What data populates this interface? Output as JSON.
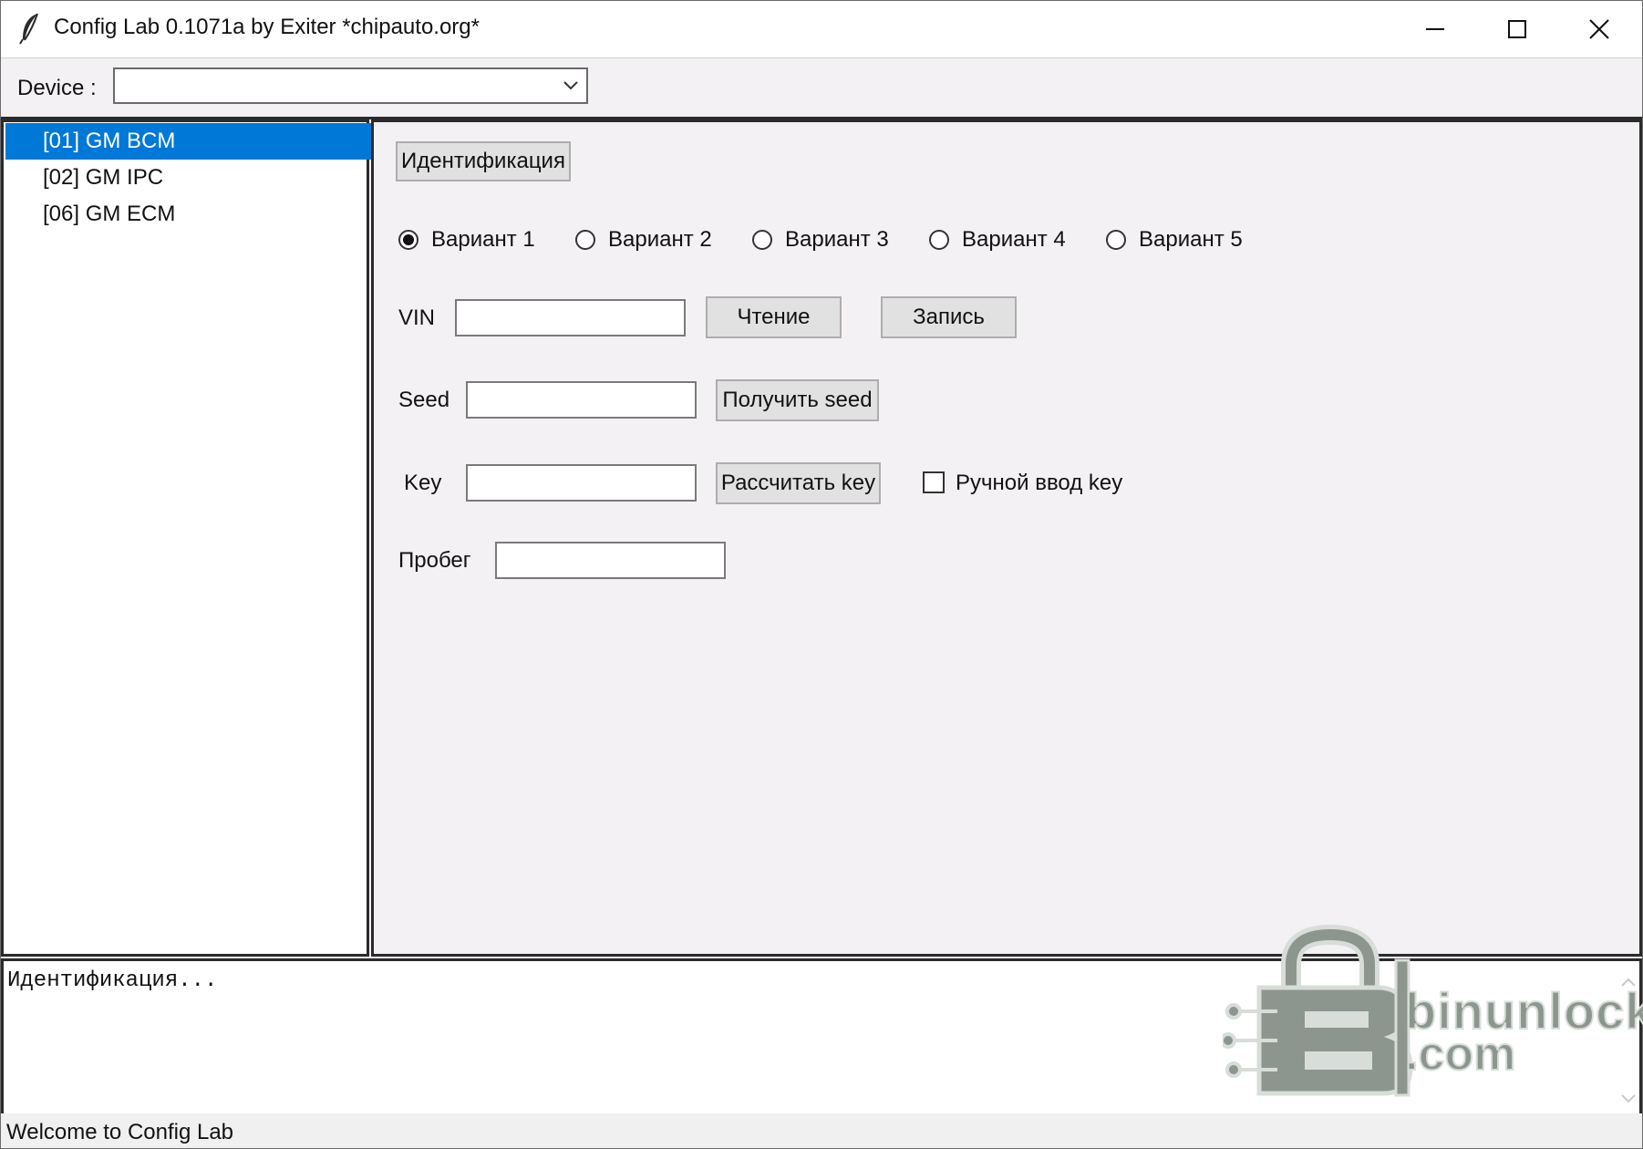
{
  "window": {
    "title": "Config Lab 0.1071a by Exiter *chipauto.org*",
    "icons": {
      "app": "feather-icon",
      "minimize": "minimize-icon",
      "maximize": "maximize-icon",
      "close": "close-icon"
    }
  },
  "device_bar": {
    "label": "Device :",
    "selected_value": ""
  },
  "device_list": {
    "items": [
      {
        "label": "[01] GM BCM",
        "selected": true
      },
      {
        "label": "[02] GM IPC",
        "selected": false
      },
      {
        "label": "[06] GM ECM",
        "selected": false
      }
    ],
    "selected_color": "#0078d7"
  },
  "main": {
    "identify_button": "Идентификация",
    "variants": [
      {
        "label": "Вариант 1",
        "checked": true
      },
      {
        "label": "Вариант 2",
        "checked": false
      },
      {
        "label": "Вариант 3",
        "checked": false
      },
      {
        "label": "Вариант 4",
        "checked": false
      },
      {
        "label": "Вариант 5",
        "checked": false
      }
    ],
    "vin": {
      "label": "VIN",
      "value": "",
      "read_button": "Чтение",
      "write_button": "Запись"
    },
    "seed": {
      "label": "Seed",
      "value": "",
      "get_button": "Получить seed"
    },
    "key": {
      "label": "Key",
      "value": "",
      "calc_button": "Рассчитать key",
      "manual_label": "Ручной ввод key",
      "manual_checked": false
    },
    "mileage": {
      "label": "Пробег",
      "value": ""
    }
  },
  "log": {
    "text": "Идентификация..."
  },
  "watermark": {
    "line1": "binunlock",
    "line2": ".com"
  },
  "status": {
    "text": "Welcome to Config Lab"
  }
}
